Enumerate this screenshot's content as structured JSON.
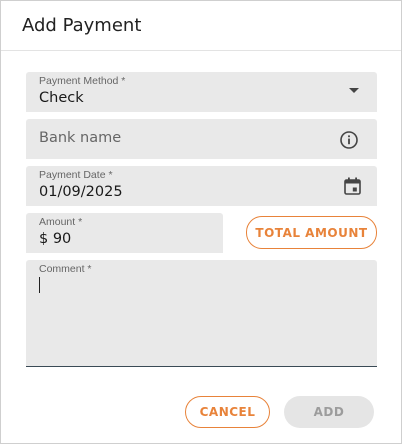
{
  "dialog": {
    "title": "Add Payment",
    "payment_method": {
      "label": "Payment Method *",
      "value": "Check"
    },
    "bank_name": {
      "placeholder": "Bank name"
    },
    "payment_date": {
      "label": "Payment Date *",
      "value": "01/09/2025"
    },
    "amount": {
      "label": "Amount *",
      "value": "$ 90"
    },
    "total_amount_button": "TOTAL AMOUNT",
    "comment": {
      "label": "Comment *",
      "value": ""
    },
    "cancel_button": "CANCEL",
    "add_button": "ADD"
  },
  "colors": {
    "accent": "#e8833a",
    "field_bg": "#e9e9e9",
    "disabled_bg": "#e5e5e5"
  },
  "icons": {
    "dropdown": "caret-down-icon",
    "info": "info-icon",
    "calendar": "calendar-icon"
  }
}
